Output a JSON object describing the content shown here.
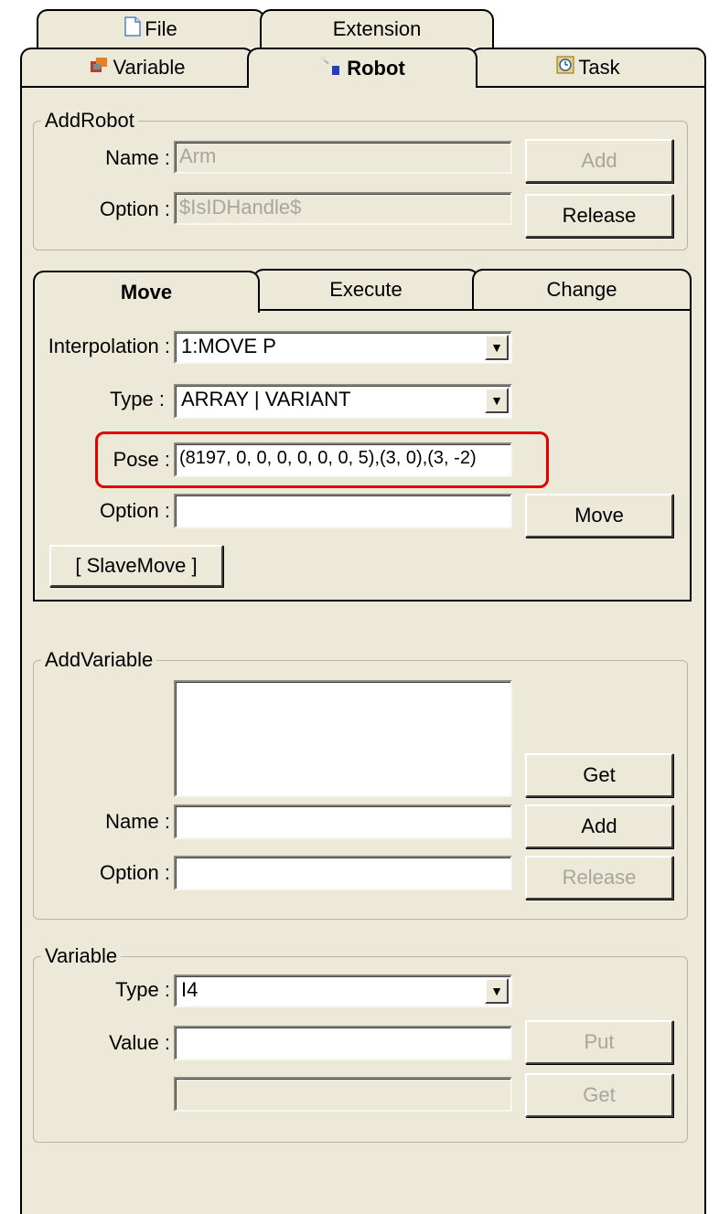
{
  "tabs_row_back": [
    {
      "label": "File",
      "icon": "file-icon"
    },
    {
      "label": "Extension"
    }
  ],
  "tabs_row_front": [
    {
      "label": "Variable",
      "icon": "variable-icon"
    },
    {
      "label": "Robot",
      "icon": "robot-icon"
    },
    {
      "label": "Task",
      "icon": "task-icon"
    }
  ],
  "add_robot": {
    "group_label": "AddRobot",
    "name_label": "Name :",
    "name_value": "Arm",
    "option_label": "Option :",
    "option_value": "$IsIDHandle$",
    "add_button": "Add",
    "release_button": "Release"
  },
  "inner_tabs": [
    {
      "label": "Move"
    },
    {
      "label": "Execute"
    },
    {
      "label": "Change"
    }
  ],
  "move": {
    "interpolation_label": "Interpolation :",
    "interpolation_value": "1:MOVE P",
    "type_label": "Type :",
    "type_value": "ARRAY | VARIANT",
    "pose_label": "Pose :",
    "pose_value": "(8197, 0, 0, 0, 0, 0, 0, 5),(3, 0),(3, -2)",
    "option_label": "Option :",
    "option_value": "",
    "move_button": "Move",
    "slave_move_button": "[ SlaveMove ]"
  },
  "add_variable": {
    "group_label": "AddVariable",
    "get_button": "Get",
    "name_label": "Name :",
    "name_value": "",
    "add_button": "Add",
    "option_label": "Option :",
    "option_value": "",
    "release_button": "Release"
  },
  "variable": {
    "group_label": "Variable",
    "type_label": "Type :",
    "type_value": "I4",
    "value_label": "Value :",
    "value_value": "",
    "put_button": "Put",
    "readout_value": "",
    "get_button": "Get"
  },
  "colors": {
    "panel_bg": "#ece9d8",
    "highlight": "#e30000",
    "disabled_text": "#a6a69a"
  }
}
